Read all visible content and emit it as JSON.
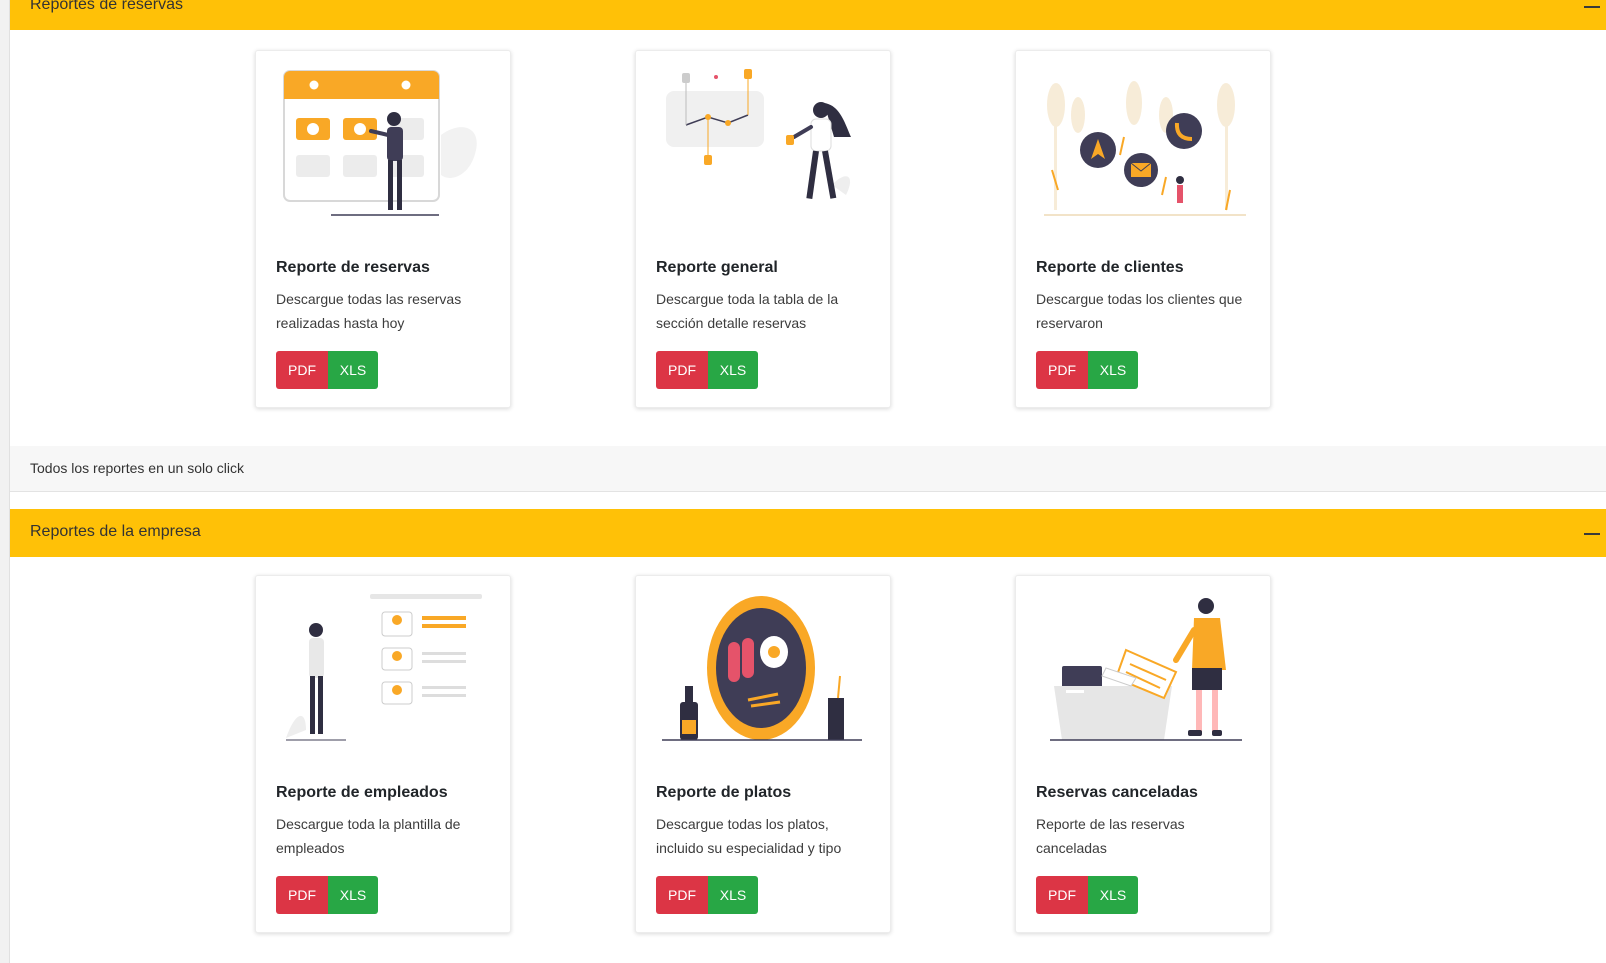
{
  "sections": [
    {
      "title": "Reportes de reservas",
      "footer": "Todos los reportes en un solo click",
      "cards": [
        {
          "title": "Reporte de reservas",
          "text": "Descargue todas las reservas realizadas hasta hoy",
          "pdf": "PDF",
          "xls": "XLS"
        },
        {
          "title": "Reporte general",
          "text": "Descargue toda la tabla de la sección detalle reservas",
          "pdf": "PDF",
          "xls": "XLS"
        },
        {
          "title": "Reporte de clientes",
          "text": "Descargue todas los clientes que reservaron",
          "pdf": "PDF",
          "xls": "XLS"
        }
      ]
    },
    {
      "title": "Reportes de la empresa",
      "cards": [
        {
          "title": "Reporte de empleados",
          "text": "Descargue toda la plantilla de empleados",
          "pdf": "PDF",
          "xls": "XLS"
        },
        {
          "title": "Reporte de platos",
          "text": "Descargue todas los platos, incluido su especialidad y tipo",
          "pdf": "PDF",
          "xls": "XLS"
        },
        {
          "title": "Reservas canceladas",
          "text": "Reporte de las reservas canceladas",
          "pdf": "PDF",
          "xls": "XLS"
        }
      ]
    }
  ],
  "colors": {
    "header": "#ffc107",
    "accent_illustration": "#f9a826",
    "pdf": "#dc3545",
    "xls": "#28a745"
  },
  "illustrations": [
    "calendar-illustration",
    "chart-illustration",
    "contacts-illustration",
    "employees-illustration",
    "dish-illustration",
    "folder-illustration"
  ]
}
